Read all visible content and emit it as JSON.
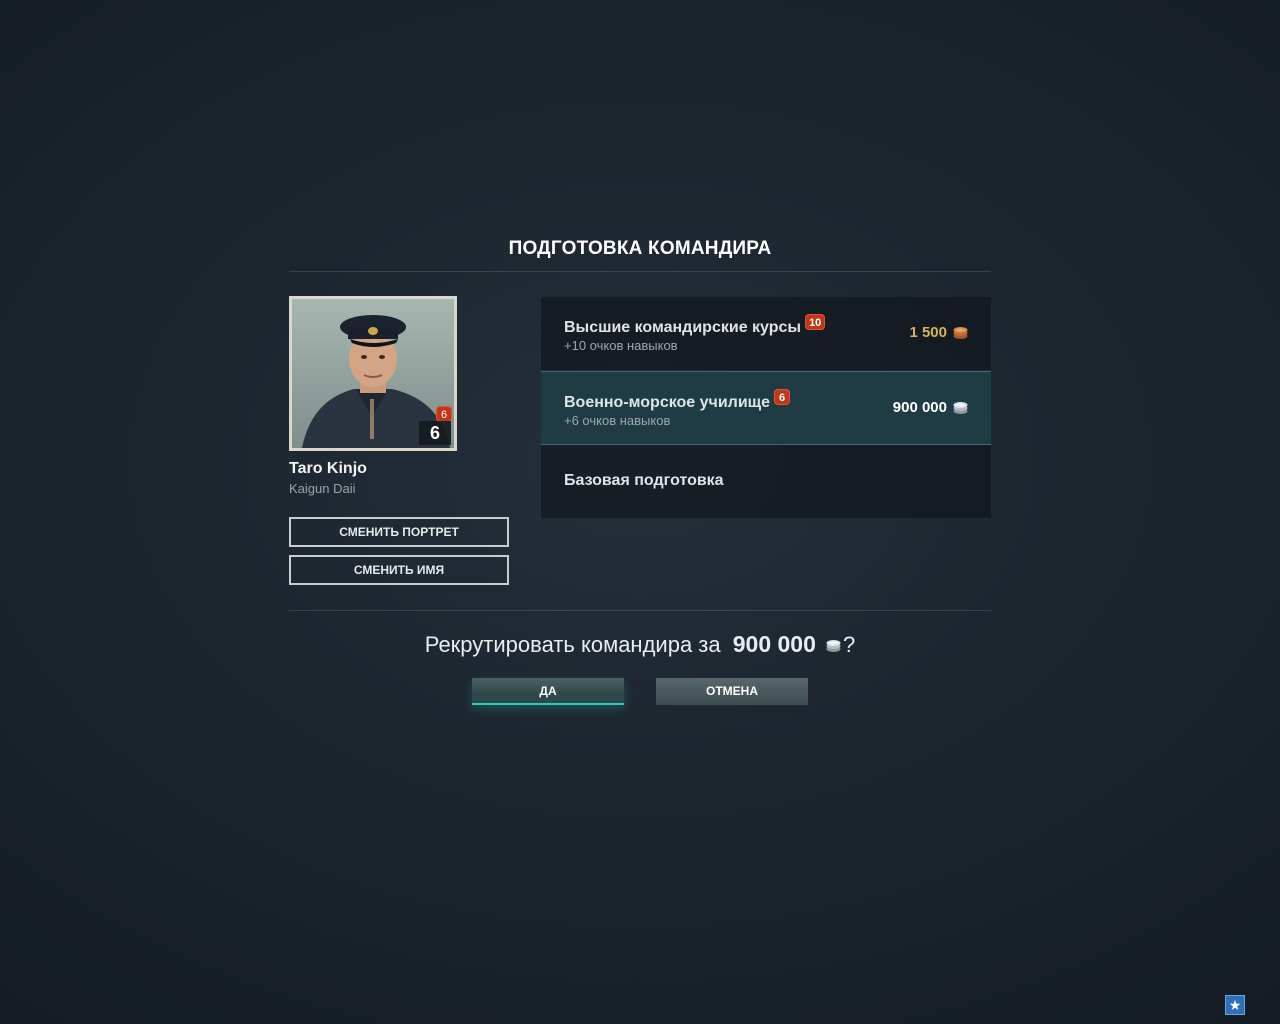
{
  "dialog": {
    "title": "ПОДГОТОВКА КОМАНДИРА"
  },
  "commander": {
    "name": "Taro Kinjo",
    "rank": "Kaigun Daii",
    "level": "6",
    "skill_badge": "6",
    "change_portrait_label": "СМЕНИТЬ ПОРТРЕТ",
    "change_name_label": "СМЕНИТЬ ИМЯ"
  },
  "options": [
    {
      "title": "Высшие командирские курсы",
      "badge": "10",
      "subtitle": "+10 очков навыков",
      "price": "1 500",
      "currency_icon": "doubloon-icon",
      "currency_color": "#d8b25a",
      "selected": false
    },
    {
      "title": "Военно-морское училище",
      "badge": "6",
      "subtitle": "+6 очков навыков",
      "price": "900 000",
      "currency_icon": "credits-icon",
      "currency_color": "#ffffff",
      "selected": true
    },
    {
      "title": "Базовая подготовка",
      "selected": false
    }
  ],
  "confirm": {
    "question_prefix": "Рекрутировать командира за",
    "amount": "900 000",
    "question_suffix": "?",
    "currency_icon": "credits-icon"
  },
  "buttons": {
    "yes_label": "ДА",
    "cancel_label": "ОТМЕНА"
  },
  "colors": {
    "accent": "#31c7b8",
    "selected_bg": "#1f3c44",
    "badge": "#c0371b",
    "gold": "#d8b25a"
  },
  "corner": {
    "icon": "star-icon",
    "glyph": "★"
  }
}
